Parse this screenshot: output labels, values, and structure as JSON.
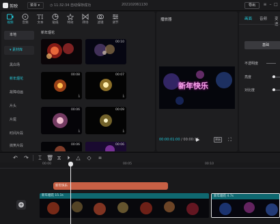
{
  "titlebar": {
    "app_name": "剪映",
    "menu_label": "菜单",
    "save_status": "11:32:34 自动保存成功",
    "project_name": "20210206113​0",
    "export_label": "导出"
  },
  "media_tabs": [
    {
      "label": "视频",
      "icon": "video-icon"
    },
    {
      "label": "音频",
      "icon": "audio-icon"
    },
    {
      "label": "文本",
      "icon": "text-icon"
    },
    {
      "label": "贴纸",
      "icon": "sticker-icon"
    },
    {
      "label": "特效",
      "icon": "effects-icon"
    },
    {
      "label": "转场",
      "icon": "transition-icon"
    },
    {
      "label": "滤镜",
      "icon": "filter-icon"
    },
    {
      "label": "调节",
      "icon": "adjust-icon"
    }
  ],
  "media_sidebar": {
    "local": "本地",
    "library": "素材库",
    "items": [
      "黑白场",
      "新年烟花",
      "故障动画",
      "片头",
      "片尾",
      "时间片段",
      "搞笑片段"
    ]
  },
  "section_title": "新年烟花",
  "thumbnails": [
    {
      "duration": "",
      "has_download": false
    },
    {
      "duration": "00:10",
      "has_download": false
    },
    {
      "duration": "00:08",
      "has_download": true
    },
    {
      "duration": "00:07",
      "has_download": true
    },
    {
      "duration": "00:06",
      "has_download": true
    },
    {
      "duration": "00:09",
      "has_download": true
    },
    {
      "duration": "00:06",
      "has_download": true
    },
    {
      "duration": "00:06",
      "has_download": false
    }
  ],
  "player": {
    "title": "播放器",
    "overlay_text": "新年快乐",
    "current_time": "00:00:01:00",
    "total_time": "00:00:17",
    "aspect_label": "原始"
  },
  "props": {
    "tabs": [
      "画面",
      "音频",
      "变速"
    ],
    "basic_label": "基础",
    "opacity_label": "不透明度",
    "brightness_label": "亮度",
    "contrast_label": "对比度"
  },
  "timeline": {
    "ticks": [
      "00:00",
      "00:05",
      "00:10",
      "00:15"
    ],
    "text_clip": "新年快乐",
    "video_clip_1": "新年烟花 15.1s",
    "video_clip_2": "新年烟花 4.7s"
  },
  "colors": {
    "accent": "#22c7d8",
    "text_clip": "#c76045",
    "video_header": "#0f6870"
  }
}
